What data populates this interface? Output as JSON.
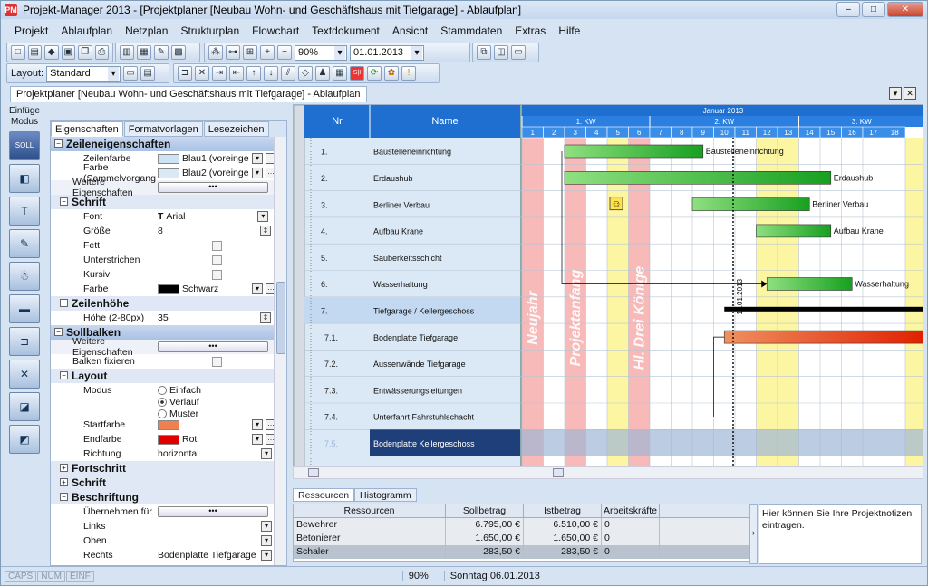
{
  "window": {
    "title": "Projekt-Manager 2013  -  [Projektplaner [Neubau Wohn- und Geschäftshaus mit Tiefgarage] - Ablaufplan]",
    "app_icon": "PM"
  },
  "window_buttons": [
    "–",
    "□",
    "✕"
  ],
  "menu": [
    "Projekt",
    "Ablaufplan",
    "Netzplan",
    "Strukturplan",
    "Flowchart",
    "Textdokument",
    "Ansicht",
    "Stammdaten",
    "Extras",
    "Hilfe"
  ],
  "toolbar1": {
    "zoom": "90%",
    "date": "01.01.2013"
  },
  "toolbar2": {
    "layout_label": "Layout:",
    "layout_value": "Standard"
  },
  "doc_tab": "Projektplaner [Neubau Wohn- und Geschäftshaus mit Tiefgarage] - Ablaufplan",
  "side": {
    "caption": "Einfüge Modus",
    "icons": [
      "SOLL",
      "◧",
      "T",
      "✎",
      "☃",
      "▬",
      "⊐",
      "✕",
      "◪",
      "◩"
    ]
  },
  "props": {
    "tabs": [
      "Eigenschaften",
      "Formatvorlagen",
      "Lesezeichen"
    ],
    "zeilen": {
      "title": "Zeileneigenschaften",
      "zeilenfarbe_l": "Zeilenfarbe",
      "zeilenfarbe_v": "Blau1 (voreingest",
      "farbe_sv_l": "Farbe (Sammelvorgang",
      "farbe_sv_v": "Blau2 (voreingest",
      "weitere_l": "Weitere Eigenschaften"
    },
    "schrift": {
      "title": "Schrift",
      "font_l": "Font",
      "font_v": "Arial",
      "groesse_l": "Größe",
      "groesse_v": "8",
      "fett_l": "Fett",
      "unter_l": "Unterstrichen",
      "kursiv_l": "Kursiv",
      "farbe_l": "Farbe",
      "farbe_v": "Schwarz"
    },
    "zhoehe": {
      "title": "Zeilenhöhe",
      "hoehe_l": "Höhe (2-80px)",
      "hoehe_v": "35"
    },
    "soll": {
      "title": "Sollbalken",
      "weitere_l": "Weitere Eigenschaften",
      "fixieren_l": "Balken fixieren"
    },
    "layout": {
      "title": "Layout",
      "modus_l": "Modus",
      "opt1": "Einfach",
      "opt2": "Verlauf",
      "opt3": "Muster",
      "start_l": "Startfarbe",
      "end_l": "Endfarbe",
      "end_v": "Rot",
      "richtung_l": "Richtung",
      "richtung_v": "horizontal"
    },
    "fortschritt": "Fortschritt",
    "schrift2": "Schrift",
    "beschriftung": {
      "title": "Beschriftung",
      "uebernehmen_l": "Übernehmen für",
      "links_l": "Links",
      "oben_l": "Oben",
      "rechts_l": "Rechts",
      "rechts_v": "Bodenplatte Tiefgarage"
    },
    "colors": {
      "blue1": "#cfe3f5",
      "blue2": "#dbe9f7",
      "black": "#000000",
      "start": "#f08050",
      "end": "#e00000"
    }
  },
  "gantt": {
    "col_nr": "Nr",
    "col_name": "Name",
    "month": "Januar 2013",
    "weeks": [
      "1. KW",
      "2. KW",
      "3. KW"
    ],
    "days": [
      "1",
      "2",
      "3",
      "4",
      "5",
      "6",
      "7",
      "8",
      "9",
      "10",
      "11",
      "12",
      "13",
      "14",
      "15",
      "16",
      "17",
      "18"
    ],
    "rows": [
      {
        "nr": "1.",
        "name": "Baustelleneinrichtung",
        "label": "Baustelleneinrichtung"
      },
      {
        "nr": "2.",
        "name": "Erdaushub",
        "label": "Erdaushub"
      },
      {
        "nr": "3.",
        "name": "Berliner Verbau",
        "label": "Berliner Verbau"
      },
      {
        "nr": "4.",
        "name": "Aufbau Krane",
        "label": "Aufbau Krane"
      },
      {
        "nr": "5.",
        "name": "Sauberkeitsschicht",
        "label": ""
      },
      {
        "nr": "6.",
        "name": "Wasserhaltung",
        "label": "Wasserhaltung"
      },
      {
        "nr": "7.",
        "name": "Tiefgarage / Kellergeschoss",
        "label": ""
      },
      {
        "nr": "7.1.",
        "name": "Bodenplatte Tiefgarage",
        "label": ""
      },
      {
        "nr": "7.2.",
        "name": "Aussenwände Tiefgarage",
        "label": ""
      },
      {
        "nr": "7.3.",
        "name": "Entwässerungsleitungen",
        "label": ""
      },
      {
        "nr": "7.4.",
        "name": "Unterfahrt Fahrstuhlschacht",
        "label": ""
      },
      {
        "nr": "7.5.",
        "name": "Bodenplatte Kellergeschoss",
        "label": ""
      }
    ],
    "holidays": [
      "Neujahr",
      "Projektanfang",
      "Hl. Drei Könige"
    ],
    "today_label": "11.01.2013"
  },
  "resources": {
    "tabs": [
      "Ressourcen",
      "Histogramm"
    ],
    "headers": [
      "Ressourcen",
      "Sollbetrag",
      "Istbetrag",
      "Arbeitskräfte"
    ],
    "rows": [
      [
        "Bewehrer",
        "6.795,00 €",
        "6.510,00 €",
        "0"
      ],
      [
        "Betonierer",
        "1.650,00 €",
        "1.650,00 €",
        "0"
      ],
      [
        "Schaler",
        "283,50 €",
        "283,50 €",
        "0"
      ]
    ]
  },
  "notes": "Hier können Sie Ihre Projektnotizen eintragen.",
  "status": {
    "caps": "CAPS",
    "num": "NUM",
    "einf": "EINF",
    "zoom": "90%",
    "date": "Sonntag 06.01.2013"
  }
}
